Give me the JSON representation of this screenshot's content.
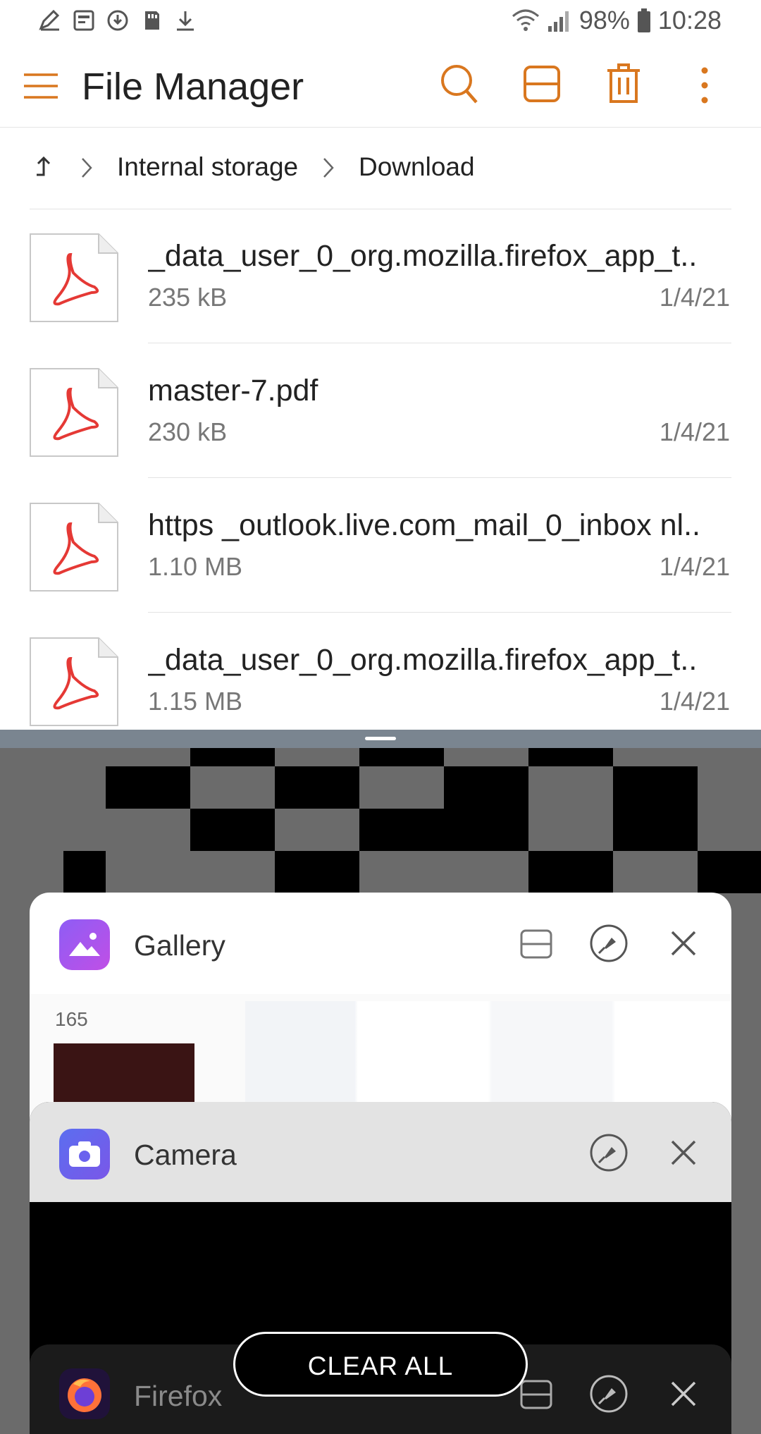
{
  "status_bar": {
    "battery": "98%",
    "time": "10:28"
  },
  "app": {
    "title": "File Manager",
    "accent": "#D9771F"
  },
  "breadcrumb": {
    "items": [
      "Internal storage",
      "Download"
    ]
  },
  "files": [
    {
      "name": "_data_user_0_org.mozilla.firefox_app_t..",
      "size": "235 kB",
      "date": "1/4/21"
    },
    {
      "name": "master-7.pdf",
      "size": "230 kB",
      "date": "1/4/21"
    },
    {
      "name": "https _outlook.live.com_mail_0_inbox nl..",
      "size": "1.10 MB",
      "date": "1/4/21"
    },
    {
      "name": "_data_user_0_org.mozilla.firefox_app_t..",
      "size": "1.15 MB",
      "date": "1/4/21"
    }
  ],
  "recents": {
    "cards": [
      {
        "label": "Gallery",
        "count": "165"
      },
      {
        "label": "Camera"
      },
      {
        "label": "Firefox"
      }
    ],
    "clear_all": "CLEAR ALL"
  }
}
